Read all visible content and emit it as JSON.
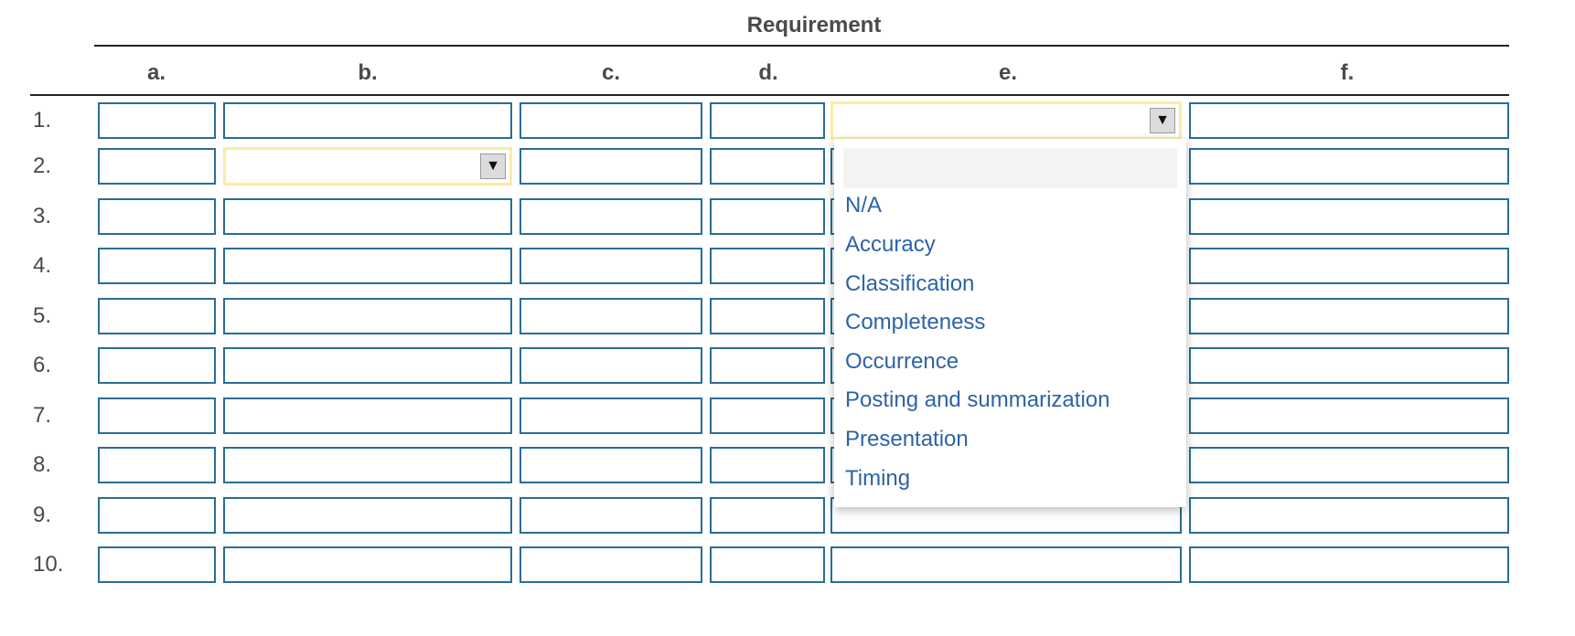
{
  "header": {
    "title": "Requirement"
  },
  "columns": [
    "a.",
    "b.",
    "c.",
    "d.",
    "e.",
    "f."
  ],
  "rows": [
    "1.",
    "2.",
    "3.",
    "4.",
    "5.",
    "6.",
    "7.",
    "8.",
    "9.",
    "10."
  ],
  "dropdown": {
    "field": "e1",
    "options": [
      "",
      "N/A",
      "Accuracy",
      "Classification",
      "Completeness",
      "Occurrence",
      "Posting and summarization",
      "Presentation",
      "Timing"
    ]
  },
  "colors": {
    "field_border": "#2a6d96",
    "focus_border": "#fdeba3",
    "option_text": "#2d63a7"
  }
}
